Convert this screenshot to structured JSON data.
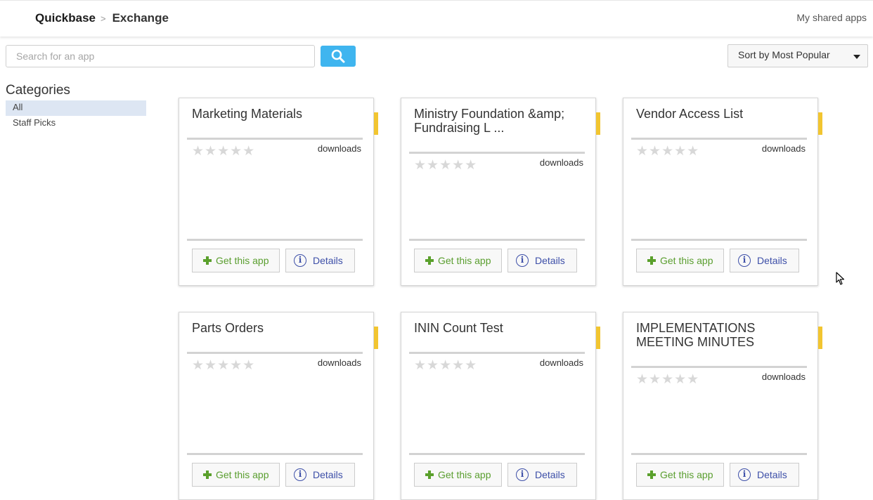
{
  "header": {
    "brand": "Quickbase",
    "separator": ">",
    "current": "Exchange",
    "shared_link": "My shared apps"
  },
  "search": {
    "placeholder": "Search for an app",
    "button_icon": "search-icon"
  },
  "sort": {
    "selected": "Sort by Most Popular",
    "icon": "caret-down-icon"
  },
  "categories": {
    "title": "Categories",
    "items": [
      {
        "label": "All",
        "active": true
      },
      {
        "label": "Staff Picks",
        "active": false
      }
    ]
  },
  "card_common": {
    "stars": "★★★★★",
    "rating": 0,
    "rating_max": 5,
    "downloads_label": "downloads",
    "get_label": "Get this app",
    "details_label": "Details",
    "details_icon_glyph": "i"
  },
  "cards": [
    {
      "title": "Marketing Materials"
    },
    {
      "title": "Ministry Foundation &amp; Fundraising L ..."
    },
    {
      "title": "Vendor Access List"
    },
    {
      "title": "Parts Orders"
    },
    {
      "title": "ININ Count Test"
    },
    {
      "title": "IMPLEMENTATIONS MEETING MINUTES"
    }
  ],
  "colors": {
    "search_button": "#3fb5ef",
    "ribbon": "#f2c530",
    "get_text": "#5a9e2f",
    "details_text": "#3d4fa8",
    "active_category": "#dde6f3"
  }
}
